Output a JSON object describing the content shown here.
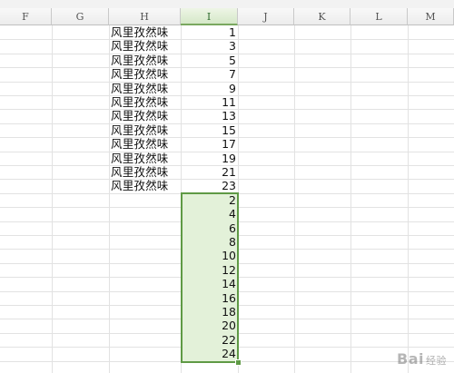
{
  "columns": [
    "F",
    "G",
    "H",
    "I",
    "J",
    "K",
    "L",
    "M"
  ],
  "active_column": "I",
  "h_column_text": [
    "风里孜然味",
    "风里孜然味",
    "风里孜然味",
    "风里孜然味",
    "风里孜然味",
    "风里孜然味",
    "风里孜然味",
    "风里孜然味",
    "风里孜然味",
    "风里孜然味",
    "风里孜然味",
    "风里孜然味"
  ],
  "i_odd_values": [
    "1",
    "3",
    "5",
    "7",
    "9",
    "11",
    "13",
    "15",
    "17",
    "19",
    "21",
    "23"
  ],
  "i_even_values": [
    "2",
    "4",
    "6",
    "8",
    "10",
    "12",
    "14",
    "16",
    "18",
    "20",
    "22",
    "24"
  ],
  "colors": {
    "selection_fill": "#e3f1d9",
    "selection_border": "#5f9a45",
    "gridline": "#e2e2e2"
  },
  "watermark": {
    "brand": "Bai",
    "suffix": "经验"
  }
}
